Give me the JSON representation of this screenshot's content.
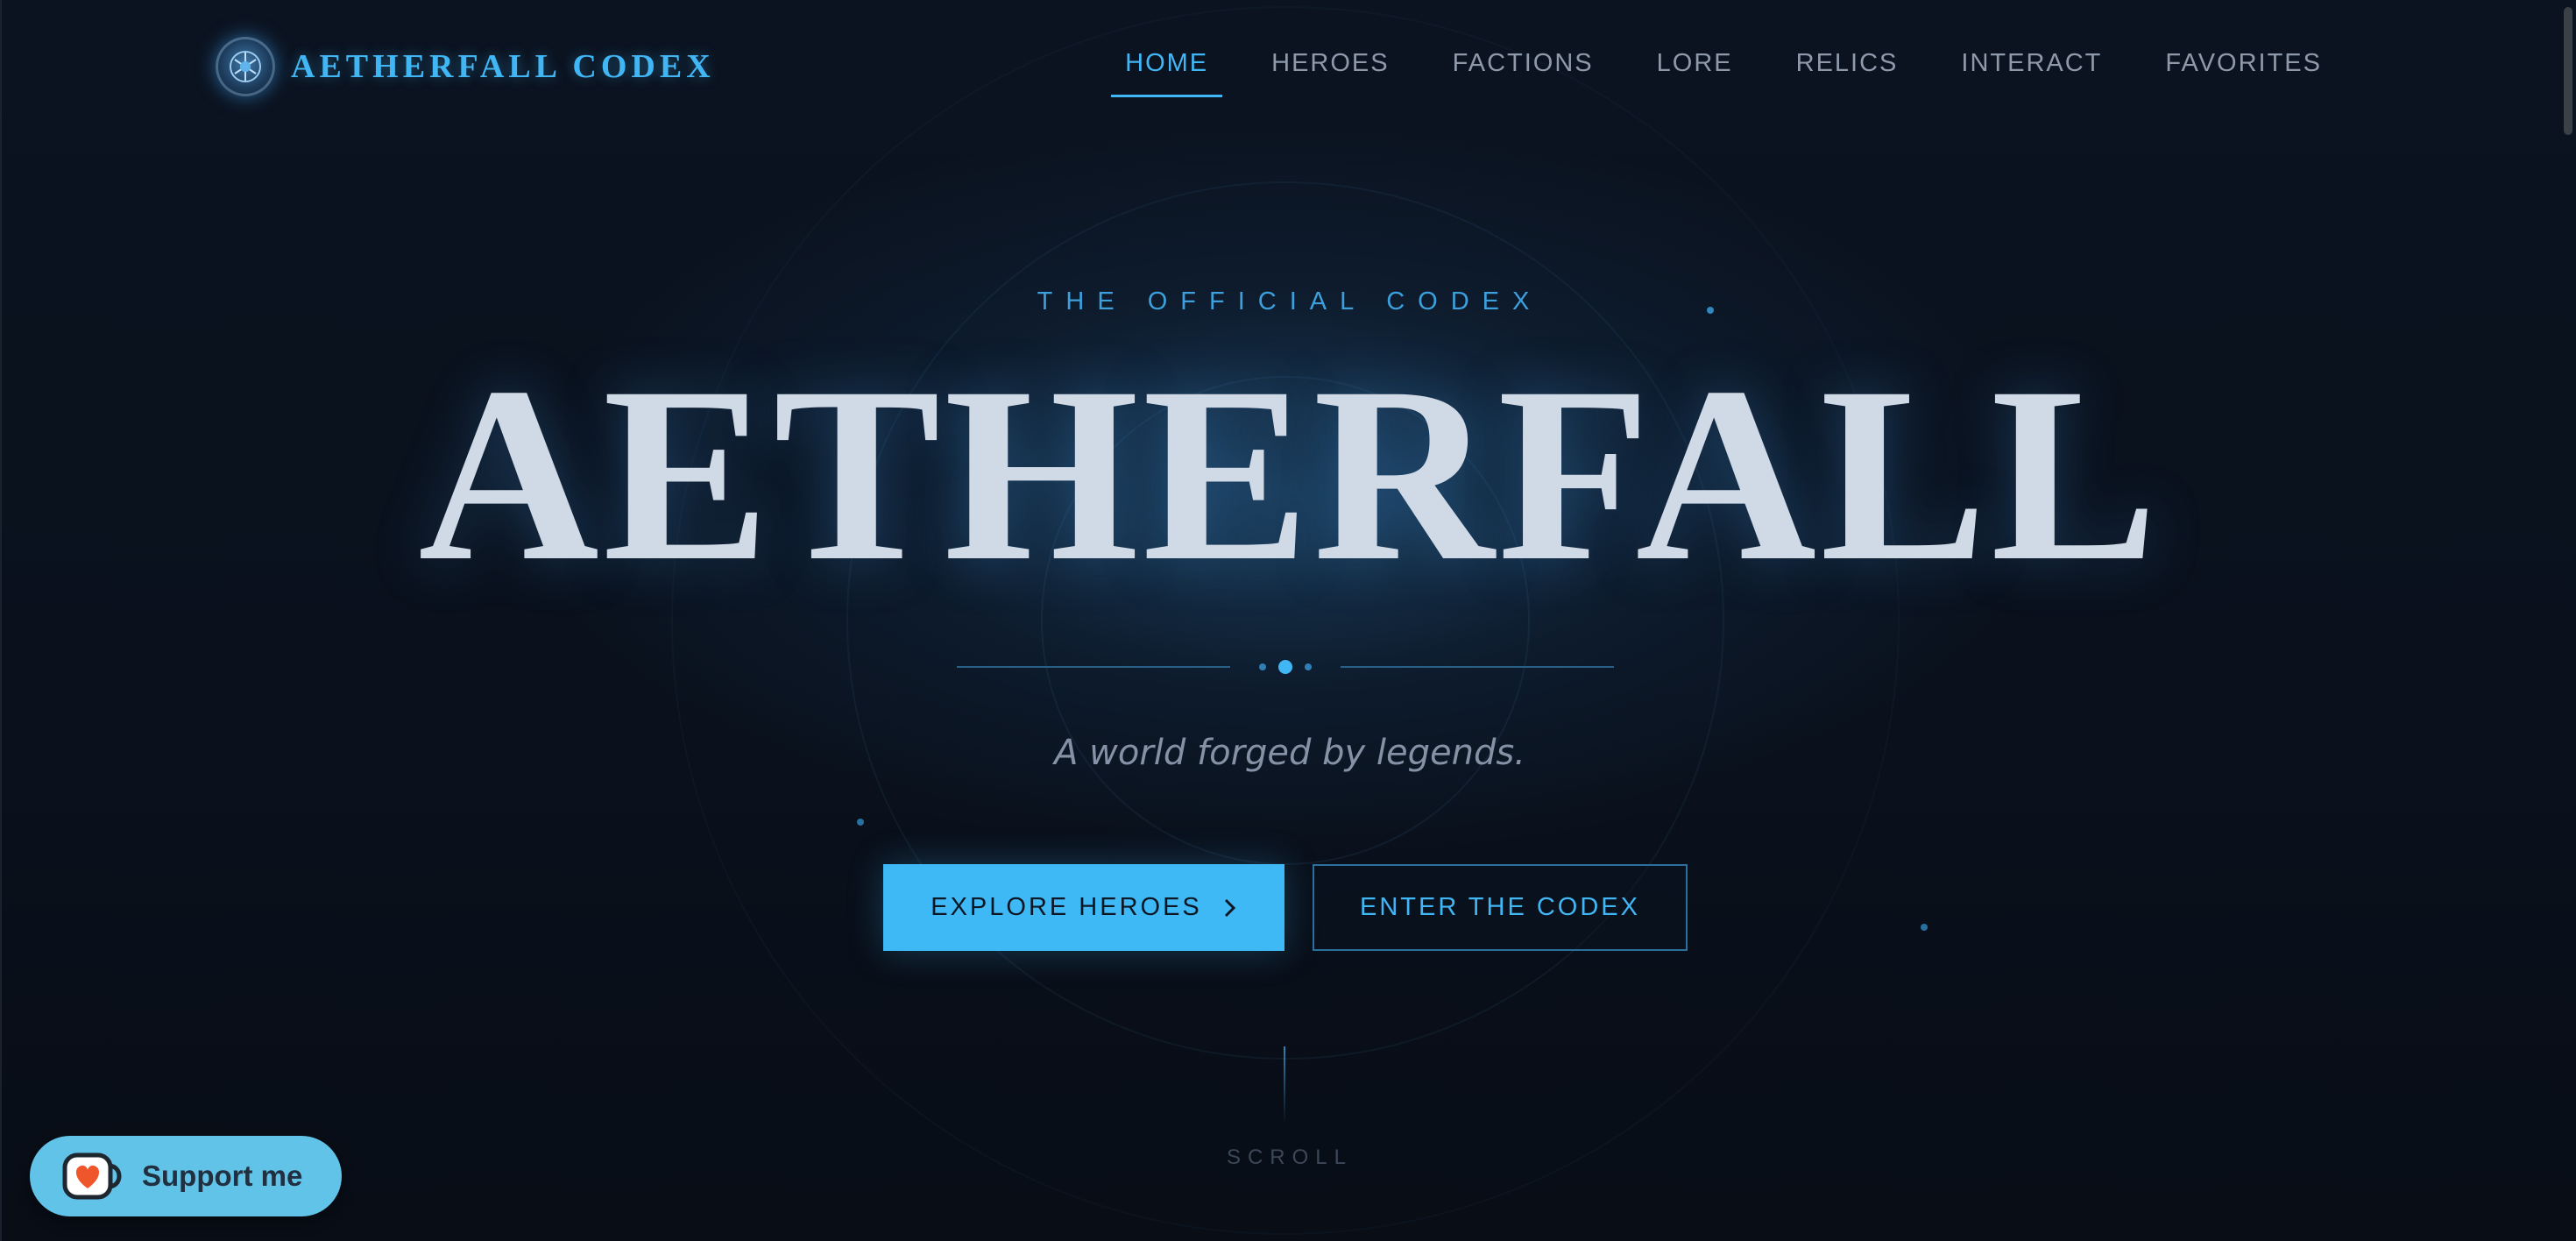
{
  "brand": {
    "name": "AETHERFALL CODEX",
    "logo_icon": "emblem-icon"
  },
  "nav": {
    "items": [
      {
        "label": "HOME",
        "active": true
      },
      {
        "label": "HEROES",
        "active": false
      },
      {
        "label": "FACTIONS",
        "active": false
      },
      {
        "label": "LORE",
        "active": false
      },
      {
        "label": "RELICS",
        "active": false
      },
      {
        "label": "INTERACT",
        "active": false
      },
      {
        "label": "FAVORITES",
        "active": false
      }
    ]
  },
  "hero": {
    "eyebrow": "THE OFFICIAL CODEX",
    "title": "AETHERFALL",
    "tagline": "A world forged by legends.",
    "primary_button": "EXPLORE HEROES",
    "primary_icon": "chevron-right-icon",
    "secondary_button": "ENTER THE CODEX",
    "scroll_label": "SCROLL"
  },
  "support": {
    "label": "Support me",
    "icon": "coffee-cup-heart-icon"
  },
  "colors": {
    "accent": "#41b6f5",
    "button_fill": "#3fb9f6",
    "background": "#0a0f19",
    "title": "#d0d9e6",
    "support_bg": "#62c3e8"
  }
}
